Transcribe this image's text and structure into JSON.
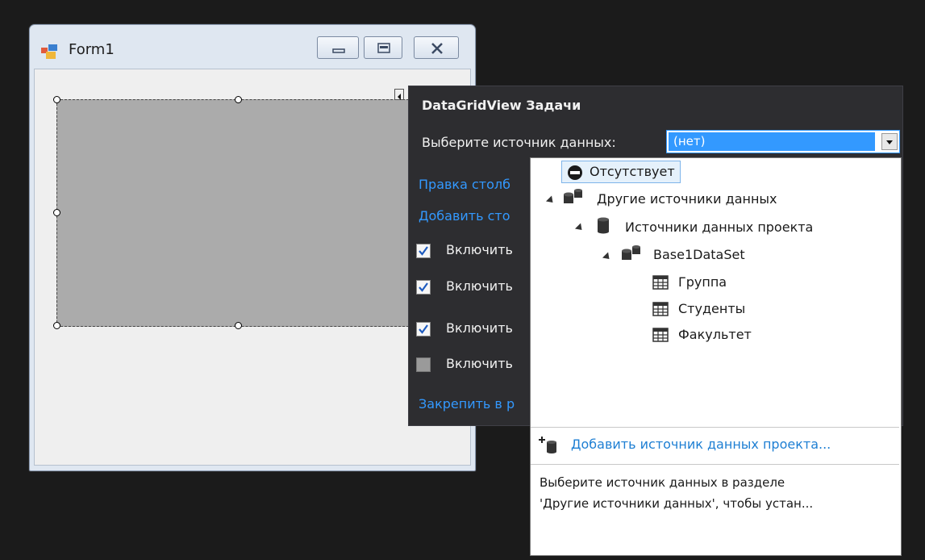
{
  "form_window": {
    "title": "Form1"
  },
  "tasks_panel": {
    "title": "DataGridView Задачи",
    "datasource_label": "Выберите источник данных:",
    "datasource_value": "(нет)",
    "links": {
      "edit_columns": "Правка столб",
      "add_column": "Добавить сто",
      "dock": "Закрепить в р"
    },
    "checkboxes": [
      {
        "label": "Включить",
        "checked": true
      },
      {
        "label": "Включить",
        "checked": true
      },
      {
        "label": "Включить",
        "checked": true
      },
      {
        "label": "Включить",
        "checked": false
      }
    ]
  },
  "dropdown": {
    "tree": {
      "none": "Отсутствует",
      "other_sources": "Другие источники данных",
      "project_sources": "Источники данных проекта",
      "dataset": "Base1DataSet",
      "tables": [
        "Группа",
        "Студенты",
        "Факультет"
      ]
    },
    "add_link": "Добавить источник данных проекта...",
    "hint_line1": "Выберите источник данных в разделе",
    "hint_line2": "'Другие источники данных', чтобы устан..."
  },
  "colors": {
    "panel_bg": "#2d2d30",
    "link": "#3399ff",
    "selection": "#3399ff"
  }
}
